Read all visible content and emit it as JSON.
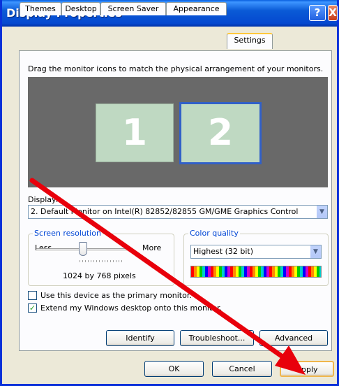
{
  "window": {
    "title": "Display Properties",
    "help_glyph": "?",
    "close_glyph": "X"
  },
  "tabs": [
    {
      "label": "Themes"
    },
    {
      "label": "Desktop"
    },
    {
      "label": "Screen Saver"
    },
    {
      "label": "Appearance"
    },
    {
      "label": "Settings",
      "active": true
    }
  ],
  "settings": {
    "hint": "Drag the monitor icons to match the physical arrangement of your monitors.",
    "monitors": [
      {
        "number": "1",
        "selected": false
      },
      {
        "number": "2",
        "selected": true
      }
    ],
    "display_label": "Display:",
    "display_value": "2. Default Monitor on Intel(R) 82852/82855 GM/GME Graphics Control",
    "resolution": {
      "title": "Screen resolution",
      "less": "Less",
      "more": "More",
      "value_text": "1024 by 768 pixels",
      "level": 0.45
    },
    "color_quality": {
      "title": "Color quality",
      "value": "Highest (32 bit)"
    },
    "primary_checkbox": {
      "label": "Use this device as the primary monitor.",
      "checked": false
    },
    "extend_checkbox": {
      "label": "Extend my Windows desktop onto this monitor.",
      "checked": true
    },
    "buttons": {
      "identify": "Identify",
      "troubleshoot": "Troubleshoot...",
      "advanced": "Advanced"
    }
  },
  "footer": {
    "ok": "OK",
    "cancel": "Cancel",
    "apply": "Apply"
  },
  "colors": {
    "title_bar": "#0a5ad6",
    "annotation_arrow": "#e8000b",
    "monitor_fill": "#bfd9c2",
    "monitor_area": "#696969"
  }
}
